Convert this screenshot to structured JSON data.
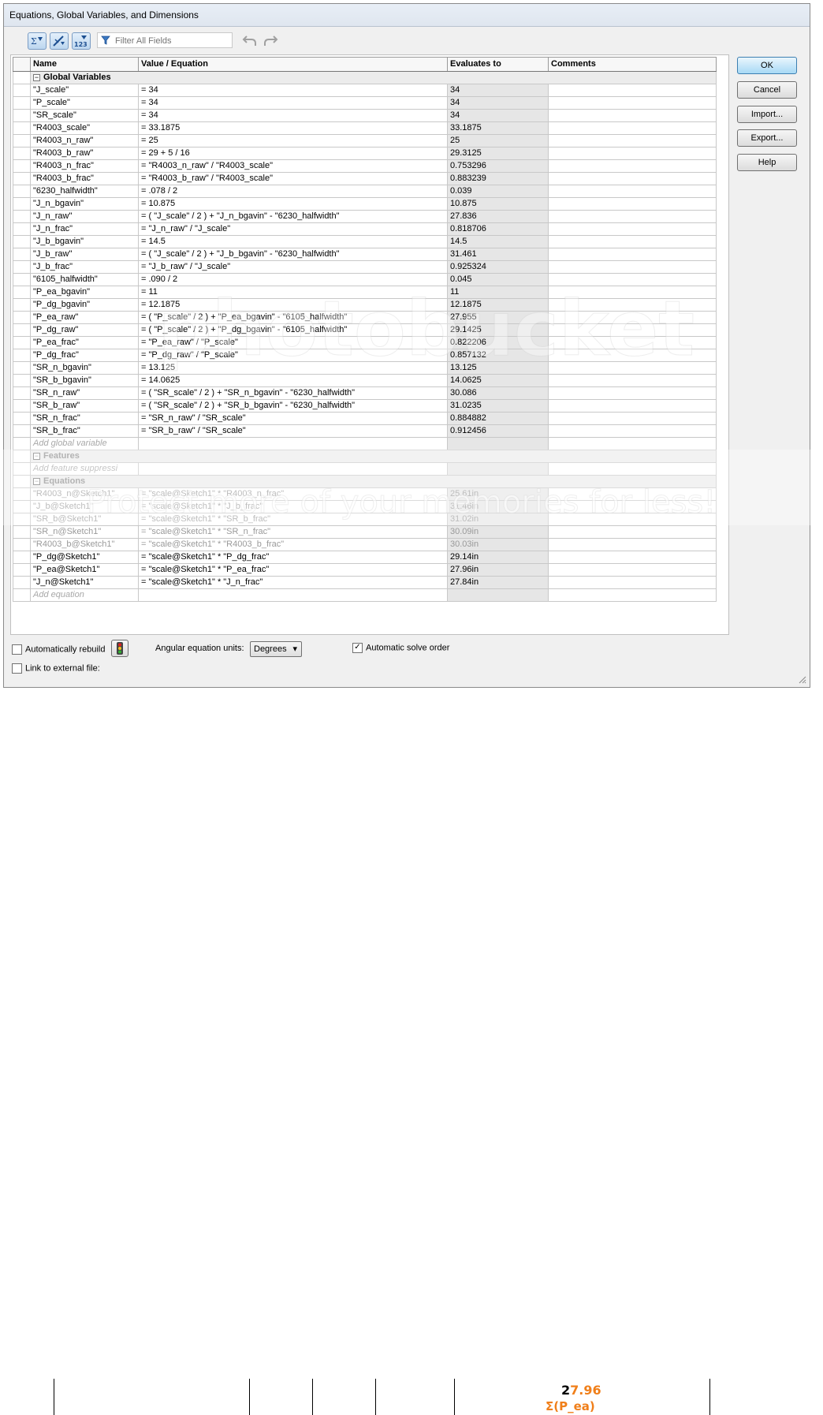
{
  "window": {
    "title": "Equations, Global Variables, and Dimensions"
  },
  "toolbar": {
    "filter_placeholder": "Filter All Fields",
    "buttons": [
      "equation-view-icon",
      "sketch-equation-view-icon",
      "ordered-view-icon"
    ]
  },
  "grid": {
    "headers": {
      "name": "Name",
      "value": "Value / Equation",
      "evaluates": "Evaluates to",
      "comments": "Comments"
    },
    "sections": {
      "global": "Global Variables",
      "features": "Features",
      "equations": "Equations"
    },
    "global_vars": [
      {
        "name": "\"J_scale\"",
        "value": "= 34",
        "eval": "34"
      },
      {
        "name": "\"P_scale\"",
        "value": "= 34",
        "eval": "34"
      },
      {
        "name": "\"SR_scale\"",
        "value": "= 34",
        "eval": "34"
      },
      {
        "name": "\"R4003_scale\"",
        "value": "= 33.1875",
        "eval": "33.1875"
      },
      {
        "name": "\"R4003_n_raw\"",
        "value": "= 25",
        "eval": "25"
      },
      {
        "name": "\"R4003_b_raw\"",
        "value": "= 29 + 5 / 16",
        "eval": "29.3125"
      },
      {
        "name": "\"R4003_n_frac\"",
        "value": "= \"R4003_n_raw\" / \"R4003_scale\"",
        "eval": "0.753296"
      },
      {
        "name": "\"R4003_b_frac\"",
        "value": "= \"R4003_b_raw\" / \"R4003_scale\"",
        "eval": "0.883239"
      },
      {
        "name": "\"6230_halfwidth\"",
        "value": "= .078 / 2",
        "eval": "0.039"
      },
      {
        "name": "\"J_n_bgavin\"",
        "value": "= 10.875",
        "eval": "10.875"
      },
      {
        "name": "\"J_n_raw\"",
        "value": "= ( \"J_scale\" / 2 ) + \"J_n_bgavin\" - \"6230_halfwidth\"",
        "eval": "27.836"
      },
      {
        "name": "\"J_n_frac\"",
        "value": "= \"J_n_raw\" / \"J_scale\"",
        "eval": "0.818706"
      },
      {
        "name": "\"J_b_bgavin\"",
        "value": "= 14.5",
        "eval": "14.5"
      },
      {
        "name": "\"J_b_raw\"",
        "value": "= ( \"J_scale\" / 2 ) + \"J_b_bgavin\" - \"6230_halfwidth\"",
        "eval": "31.461"
      },
      {
        "name": "\"J_b_frac\"",
        "value": "= \"J_b_raw\" / \"J_scale\"",
        "eval": "0.925324"
      },
      {
        "name": "\"6105_halfwidth\"",
        "value": "= .090 / 2",
        "eval": "0.045"
      },
      {
        "name": "\"P_ea_bgavin\"",
        "value": "= 11",
        "eval": "11"
      },
      {
        "name": "\"P_dg_bgavin\"",
        "value": "= 12.1875",
        "eval": "12.1875"
      },
      {
        "name": "\"P_ea_raw\"",
        "value": "= ( \"P_scale\" / 2 ) + \"P_ea_bgavin\" - \"6105_halfwidth\"",
        "eval": "27.955"
      },
      {
        "name": "\"P_dg_raw\"",
        "value": "= ( \"P_scale\" / 2 ) + \"P_dg_bgavin\" - \"6105_halfwidth\"",
        "eval": "29.1425"
      },
      {
        "name": "\"P_ea_frac\"",
        "value": "= \"P_ea_raw\" / \"P_scale\"",
        "eval": "0.822206"
      },
      {
        "name": "\"P_dg_frac\"",
        "value": "= \"P_dg_raw\" / \"P_scale\"",
        "eval": "0.857132"
      },
      {
        "name": "\"SR_n_bgavin\"",
        "value": "= 13.125",
        "eval": "13.125"
      },
      {
        "name": "\"SR_b_bgavin\"",
        "value": "= 14.0625",
        "eval": "14.0625"
      },
      {
        "name": "\"SR_n_raw\"",
        "value": "= ( \"SR_scale\" / 2 ) + \"SR_n_bgavin\" - \"6230_halfwidth\"",
        "eval": "30.086"
      },
      {
        "name": "\"SR_b_raw\"",
        "value": "= ( \"SR_scale\" / 2 ) + \"SR_b_bgavin\" - \"6230_halfwidth\"",
        "eval": "31.0235"
      },
      {
        "name": "\"SR_n_frac\"",
        "value": "= \"SR_n_raw\" / \"SR_scale\"",
        "eval": "0.884882"
      },
      {
        "name": "\"SR_b_frac\"",
        "value": "= \"SR_b_raw\" / \"SR_scale\"",
        "eval": "0.912456"
      }
    ],
    "add_global": "Add global variable",
    "add_feature": "Add feature suppressi",
    "equations": [
      {
        "name": "\"R4003_n@Sketch1\"",
        "value": "= \"scale@Sketch1\" * \"R4003_n_frac\"",
        "eval": "25.61in",
        "dim": true
      },
      {
        "name": "\"J_b@Sketch1\"",
        "value": "= \"scale@Sketch1\" * \"J_b_frac\"",
        "eval": "31.46in",
        "dim": true
      },
      {
        "name": "\"SR_b@Sketch1\"",
        "value": "= \"scale@Sketch1\" * \"SR_b_frac\"",
        "eval": "31.02in",
        "dim": true
      },
      {
        "name": "\"SR_n@Sketch1\"",
        "value": "= \"scale@Sketch1\" * \"SR_n_frac\"",
        "eval": "30.09in",
        "dim": true
      },
      {
        "name": "\"R4003_b@Sketch1\"",
        "value": "= \"scale@Sketch1\" * \"R4003_b_frac\"",
        "eval": "30.03in",
        "dim": true
      },
      {
        "name": "\"P_dg@Sketch1\"",
        "value": "= \"scale@Sketch1\" * \"P_dg_frac\"",
        "eval": "29.14in",
        "dim": false
      },
      {
        "name": "\"P_ea@Sketch1\"",
        "value": "= \"scale@Sketch1\" * \"P_ea_frac\"",
        "eval": "27.96in",
        "dim": false
      },
      {
        "name": "\"J_n@Sketch1\"",
        "value": "= \"scale@Sketch1\" * \"J_n_frac\"",
        "eval": "27.84in",
        "dim": false
      }
    ],
    "add_equation": "Add equation"
  },
  "buttons": {
    "ok": "OK",
    "cancel": "Cancel",
    "import": "Import...",
    "export": "Export...",
    "help": "Help"
  },
  "bottom": {
    "auto_rebuild": "Automatically rebuild",
    "auto_rebuild_checked": false,
    "angular_label": "Angular equation units:",
    "angular_value": "Degrees",
    "auto_solve": "Automatic solve order",
    "auto_solve_checked": true,
    "link_external": "Link to external file:",
    "link_external_checked": false
  },
  "background": {
    "dimension_value": "27.96",
    "dimension_label": "Σ(P_ea)"
  },
  "watermark": {
    "text_1": "photobucket",
    "text_2": "Protect more of your memories for less!"
  },
  "colors": {
    "accent_orange": "#f07f1a",
    "evaluates_bg": "#e6e6e6",
    "ok_blue": "#a7d9f5"
  }
}
